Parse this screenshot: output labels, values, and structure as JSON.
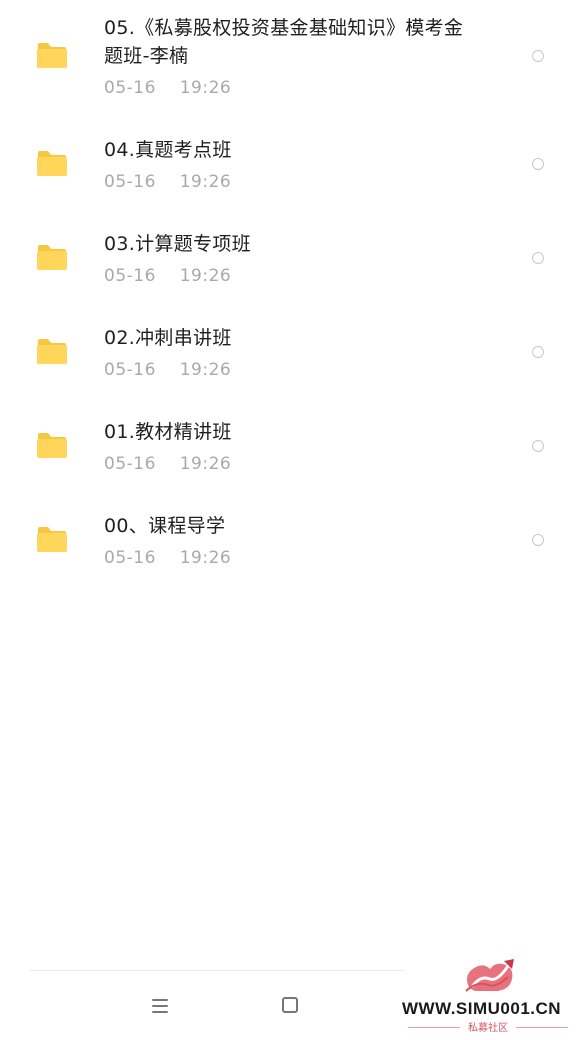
{
  "files": [
    {
      "name_line1": "05.《私募股权投资基金基础知识》模考金",
      "name_line2": "题班-李楠",
      "date": "05-16  19:26"
    },
    {
      "name_line1": "04.真题考点班",
      "date": "05-16  19:26"
    },
    {
      "name_line1": "03.计算题专项班",
      "date": "05-16  19:26"
    },
    {
      "name_line1": "02.冲刺串讲班",
      "date": "05-16  19:26"
    },
    {
      "name_line1": "01.教材精讲班",
      "date": "05-16  19:26"
    },
    {
      "name_line1": "00、课程导学",
      "date": "05-16  19:26"
    }
  ],
  "icons": {
    "item": "folder-icon",
    "select": "radio-circle",
    "nav_left": "menu-icon",
    "nav_center": "home-square-icon"
  },
  "colors": {
    "folder": "#FFD659",
    "folder_tab": "#F7C743",
    "text": "#1f1f1f",
    "date": "#a8a8ae",
    "watermark_red": "#d9535f"
  },
  "watermark": {
    "url": "WWW.SIMU001.CN",
    "subtitle": "私募社区"
  }
}
